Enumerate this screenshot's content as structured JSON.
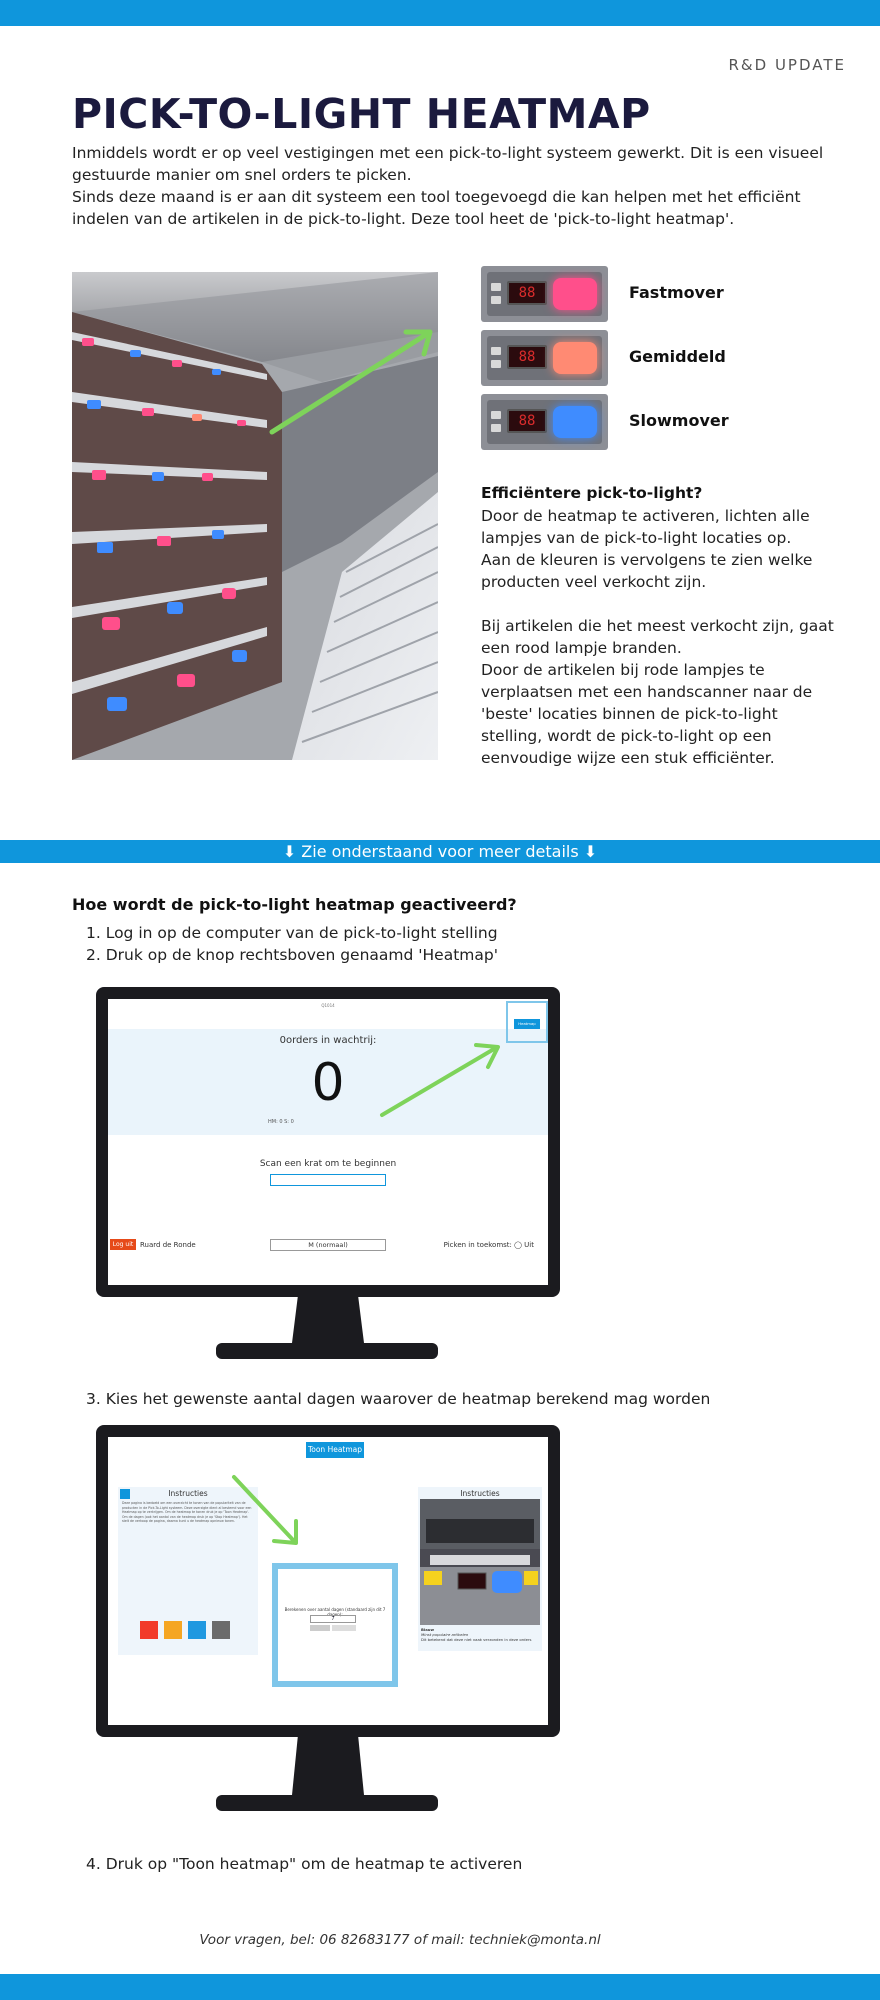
{
  "header": {
    "tag": "R&D UPDATE",
    "title": "PICK-TO-LIGHT HEATMAP"
  },
  "intro": {
    "p1": "Inmiddels wordt er op veel vestigingen met een pick-to-light systeem gewerkt. Dit is een visueel gestuurde manier om snel orders te picken.",
    "p2": "Sinds deze maand is er aan dit systeem een tool toegevoegd die kan helpen met het efficiënt indelen van de artikelen in de pick-to-light. Deze tool heet de 'pick-to-light heatmap'."
  },
  "legend": {
    "items": [
      {
        "label": "Fastmover",
        "color": "#ff4f8b",
        "digits": "88"
      },
      {
        "label": "Gemiddeld",
        "color": "#ff8a73",
        "digits": "88"
      },
      {
        "label": "Slowmover",
        "color": "#3f8cff",
        "digits": "88"
      }
    ]
  },
  "side": {
    "heading": "Efficiëntere pick-to-light?",
    "p1": "Door de heatmap te activeren, lichten alle lampjes van de pick-to-light locaties op.",
    "p2": "Aan de kleuren is vervolgens te zien welke producten veel verkocht zijn.",
    "p3": "Bij artikelen die het meest verkocht zijn, gaat een rood lampje branden.",
    "p4": "Door de artikelen bij rode lampjes te verplaatsen met een handscanner naar de 'beste' locaties binnen de pick-to-light stelling, wordt de pick-to-light op een eenvoudige wijze een stuk efficiënter."
  },
  "banner": {
    "text": "⬇ Zie onderstaand voor meer details ⬇"
  },
  "how": {
    "heading": "Hoe wordt de pick-to-light heatmap geactiveerd?",
    "step1": "1.  Log in op de computer van de pick-to-light stelling",
    "step2": "2.  Druk op de knop rechtsboven genaamd 'Heatmap'",
    "step3": "3. Kies het gewenste aantal dagen waarover de heatmap berekend mag worden",
    "step4": "4. Druk op \"Toon heatmap\" om de heatmap te activeren"
  },
  "screen1": {
    "top_small": "Q1014",
    "heatmap_btn": "Heatmap",
    "orders_label": "0orders in wachtrij:",
    "count": "0",
    "small_stats": "HM: 0    S: 0",
    "scan_label": "Scan een krat om te beginnen",
    "logout": "Log uit",
    "user": "Ruard de Ronde",
    "mode": "M (normaal)",
    "future": "Picken in toekomst:  ◯ Uit"
  },
  "screen2": {
    "show_btn": "Toon Heatmap",
    "left_title": "Instructies",
    "left_text": "Deze pagina is bedoeld om een overzicht te tonen van de populariteit van de producten in de Pick-To-Light systeem. Deze overzigte dient al bestemd voor een Heatmap op te verkrijgen. Om de heatmap te tonen druk je op 'Toon Heatmap'. Om de dagen (ook het aantal van de heatmap druk je op 'Stop Heatmap'). Het stelt de verkoop de pagina, daarna kunt u de heatmap opnieuw tonen.",
    "right_title": "Instructies",
    "right_caption_1": "Blauw",
    "right_caption_2": "Minst populaire artikelen",
    "right_caption_3": "Dit betekend dat deze niet vaak verzonden in deze orders",
    "modal_text": "Berekenen over aantal dagen (standaard zijn dit 7 dagen):",
    "modal_value": "7",
    "squares": [
      "#f23b2b",
      "#f5a623",
      "#1f98e0",
      "#6b6b6b"
    ]
  },
  "footer": {
    "text": "Voor vragen, bel: 06 82683177 of mail: techniek@monta.nl"
  },
  "colors": {
    "brand_blue": "#0f96dc",
    "title_navy": "#1b1a3e",
    "arrow_green": "#7ed35a"
  }
}
